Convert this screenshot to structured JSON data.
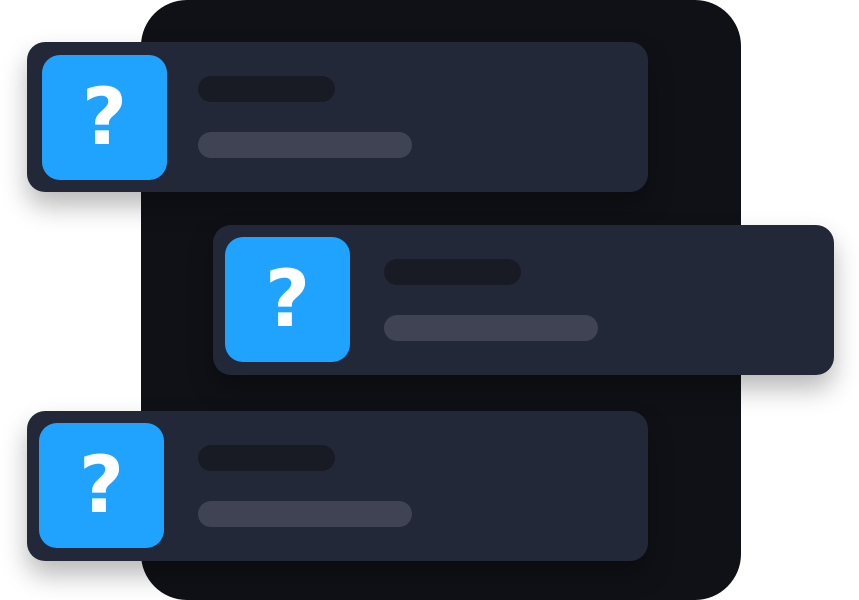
{
  "colors": {
    "backdrop": "#0f1116",
    "card": "#232838",
    "tile": "#1fa3ff",
    "title_placeholder": "#181b24",
    "subtitle_placeholder": "#3f4354",
    "glyph": "#ffffff"
  },
  "cards": [
    {
      "icon": "question-mark-icon",
      "glyph": "?"
    },
    {
      "icon": "question-mark-icon",
      "glyph": "?"
    },
    {
      "icon": "question-mark-icon",
      "glyph": "?"
    }
  ]
}
